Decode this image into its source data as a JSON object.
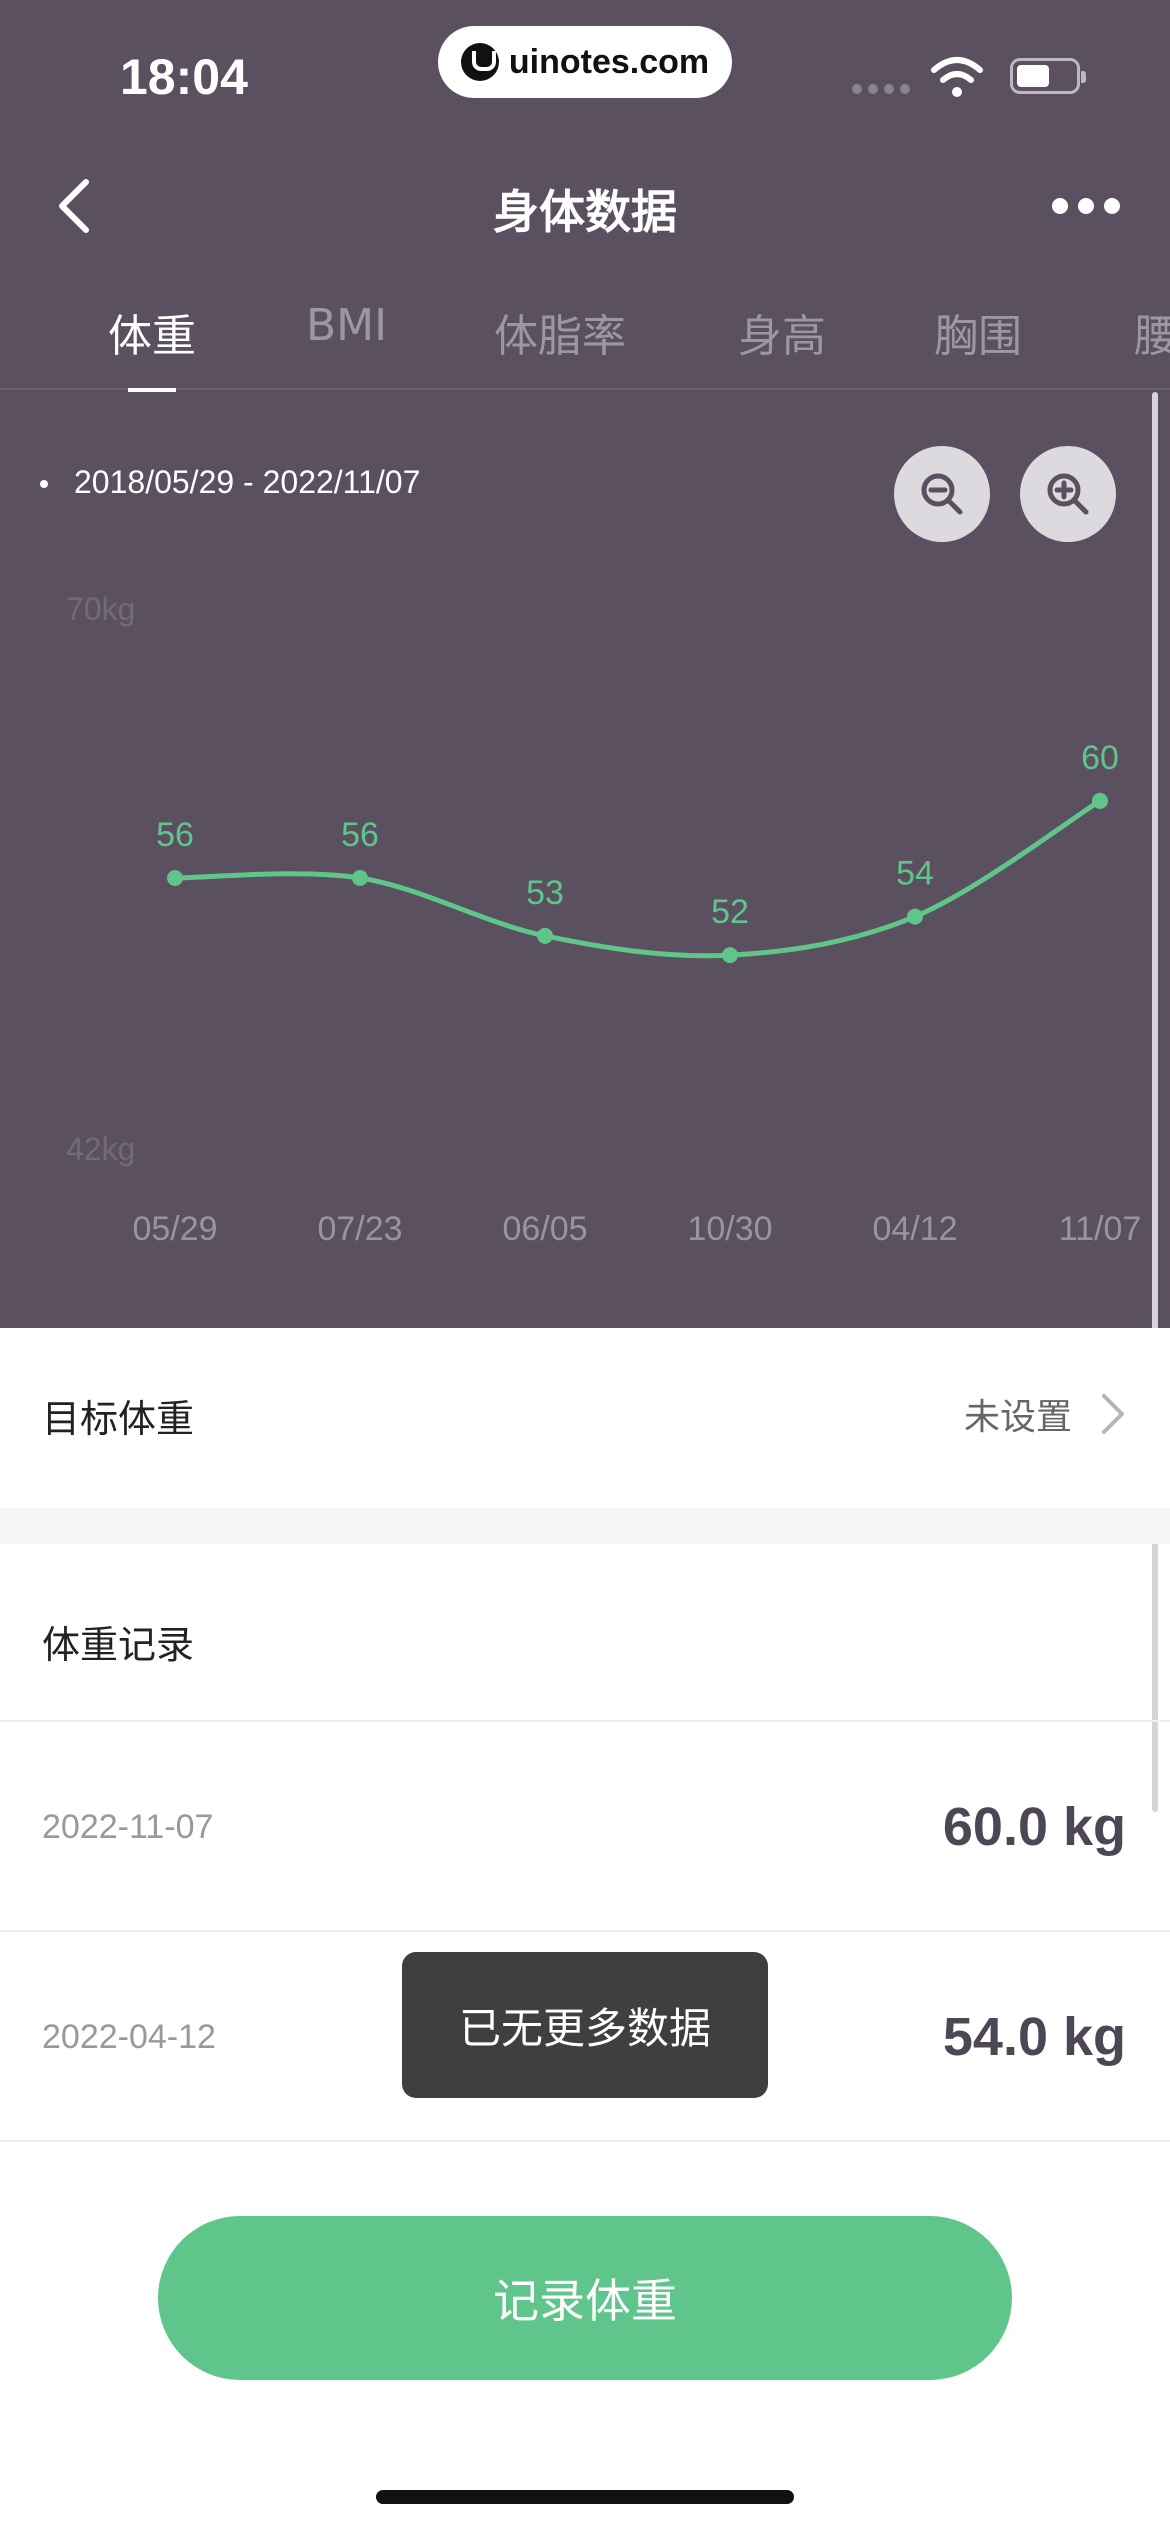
{
  "status_bar": {
    "time": "18:04",
    "url": "uinotes.com"
  },
  "nav": {
    "title": "身体数据"
  },
  "tabs": [
    {
      "label": "体重",
      "active": true
    },
    {
      "label": "BMI",
      "active": false
    },
    {
      "label": "体脂率",
      "active": false
    },
    {
      "label": "身高",
      "active": false
    },
    {
      "label": "胸围",
      "active": false
    },
    {
      "label": "腰",
      "active": false
    }
  ],
  "range": {
    "text": "2018/05/29 - 2022/11/07"
  },
  "chart_data": {
    "type": "line",
    "x": [
      "05/29",
      "07/23",
      "06/05",
      "10/30",
      "04/12",
      "11/07"
    ],
    "series": [
      {
        "values": [
          56,
          56,
          53,
          52,
          54,
          60
        ],
        "color": "#5fc58a"
      }
    ],
    "data_labels": [
      "56",
      "56",
      "53",
      "52",
      "54",
      "60"
    ],
    "y_tick_labels": [
      "70kg",
      "42kg"
    ],
    "ylim": [
      42,
      70
    ],
    "grid": false
  },
  "target_weight": {
    "label": "目标体重",
    "value": "未设置"
  },
  "records": {
    "title": "体重记录",
    "items": [
      {
        "date": "2022-11-07",
        "value": "60.0 kg"
      },
      {
        "date": "2022-04-12",
        "value": "54.0 kg"
      }
    ]
  },
  "toast": "已无更多数据",
  "record_button": "记录体重",
  "colors": {
    "header_bg": "#5a5060",
    "accent": "#5fc58a"
  }
}
